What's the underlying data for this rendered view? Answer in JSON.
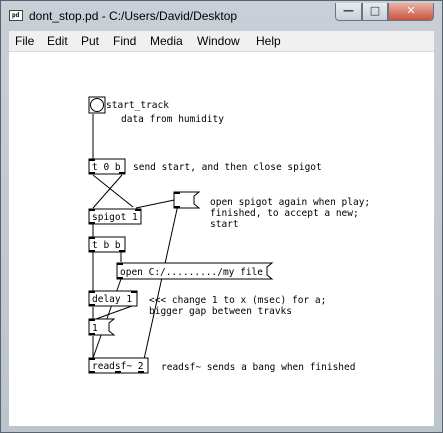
{
  "window": {
    "title": "dont_stop.pd  - C:/Users/David/Desktop",
    "app_icon_text": "pd",
    "controls": {
      "minimize": "—",
      "maximize": "□",
      "close": "✕"
    }
  },
  "menubar": [
    "File",
    "Edit",
    "Put",
    "Find",
    "Media",
    "Window",
    "Help"
  ],
  "patch": {
    "bang_label": "start_track",
    "comment_humidity": "data from humidity",
    "obj_trigger_0b": "t 0 b",
    "comment_send_start": "send start, and then close spigot",
    "comment_open_spigot": [
      "open spigot again when play;",
      "finished, to accept a new;",
      "start"
    ],
    "obj_spigot": "spigot 1",
    "obj_trigger_bb": "t b b",
    "msg_open": "open C:/........./my file",
    "obj_delay": "delay 1",
    "comment_delay": [
      "<<< change 1 to x (msec) for a;",
      "bigger gap between travks"
    ],
    "msg_1": "1",
    "obj_readsf": "readsf~ 2",
    "comment_readsf": "readsf~ sends a bang when finished"
  },
  "colors": {
    "canvas": "#ffffff",
    "close_button": "#c9533e",
    "object_border": "#000000",
    "connection": "#000000"
  }
}
